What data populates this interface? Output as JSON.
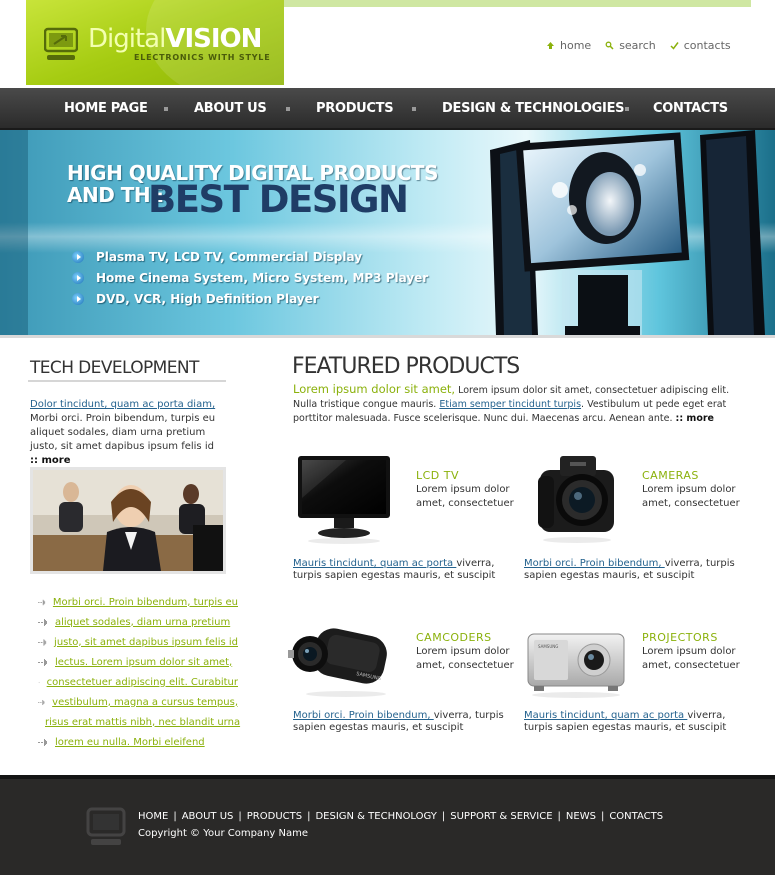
{
  "brand": {
    "word_light": "Digital",
    "word_bold": "VISION",
    "tagline": "ELECTRONICS WITH STYLE"
  },
  "top_links": [
    {
      "label": "home",
      "icon": "home-icon"
    },
    {
      "label": "search",
      "icon": "search-icon"
    },
    {
      "label": "contacts",
      "icon": "check-icon"
    }
  ],
  "nav": {
    "items": [
      "HOME PAGE",
      "ABOUT US",
      "PRODUCTS",
      "DESIGN & TECHNOLOGIES",
      "CONTACTS"
    ]
  },
  "banner": {
    "headline_line1": "HIGH QUALITY DIGITAL PRODUCTS",
    "headline_line2": "AND THE",
    "headline_big": "BEST DESIGN",
    "bullets": [
      "Plasma TV, LCD TV, Commercial Display",
      "Home Cinema System, Micro System, MP3 Player",
      "DVD, VCR, High Definition Player"
    ]
  },
  "sidebar": {
    "title": "TECH DEVELOPMENT",
    "intro_link": "Dolor tincidunt, quam ac porta diam,",
    "intro_text": "Morbi orci. Proin bibendum, turpis eu aliquet sodales, diam urna pretium justo, sit amet dapibus ipsum felis id",
    "more_label": "more",
    "links": [
      "Morbi orci. Proin bibendum, turpis eu",
      "aliquet sodales, diam urna pretium",
      "justo, sit amet dapibus ipsum felis id",
      "lectus. Lorem ipsum dolor sit amet,",
      "consectetuer adipiscing elit. Curabitur",
      "vestibulum, magna a cursus tempus,",
      "risus erat mattis nibh, nec blandit urna",
      "lorem eu nulla. Morbi eleifend"
    ]
  },
  "featured": {
    "title": "FEATURED PRODUCTS",
    "intro_highlight": "Lorem ipsum dolor sit amet,",
    "intro_text1": "Lorem ipsum dolor sit amet, consectetuer adipiscing elit. Nulla tristique congue mauris.",
    "intro_link": "Etiam semper tincidunt turpis",
    "intro_text2": ". Vestibulum ut pede eget erat porttitor malesuada. Fusce scelerisque. Nunc dui. Maecenas arcu. Aenean ante.",
    "more_label": "more",
    "products": [
      {
        "title": "LCD TV",
        "desc": "Lorem ipsum dolor amet, consectetuer",
        "foot_link": "Mauris tincidunt, quam ac porta ",
        "foot_text": "viverra, turpis sapien egestas mauris, et suscipit"
      },
      {
        "title": "CAMERAS",
        "desc": "Lorem ipsum dolor amet, consectetuer",
        "foot_link": "Morbi orci. Proin bibendum, ",
        "foot_text": "viverra, turpis sapien egestas mauris, et suscipit"
      },
      {
        "title": "CAMCODERS",
        "desc": "Lorem ipsum dolor amet, consectetuer",
        "foot_link": "Morbi orci. Proin bibendum, ",
        "foot_text": "viverra, turpis sapien egestas mauris, et suscipit"
      },
      {
        "title": "PROJECTORS",
        "desc": "Lorem ipsum dolor amet, consectetuer",
        "foot_link": "Mauris tincidunt, quam ac porta ",
        "foot_text": "viverra, turpis sapien egestas mauris, et suscipit"
      }
    ]
  },
  "footer": {
    "links": [
      "HOME",
      "ABOUT US",
      "PRODUCTS",
      "DESIGN & TECHNOLOGY",
      "SUPPORT & SERVICE",
      "NEWS",
      "CONTACTS"
    ],
    "copyright": "Copyright © Your Company Name"
  },
  "colors": {
    "accent_green": "#8bb10c",
    "link_blue": "#24628e",
    "nav_dark": "#2b2b2b",
    "footer_dark": "#2a2928"
  }
}
